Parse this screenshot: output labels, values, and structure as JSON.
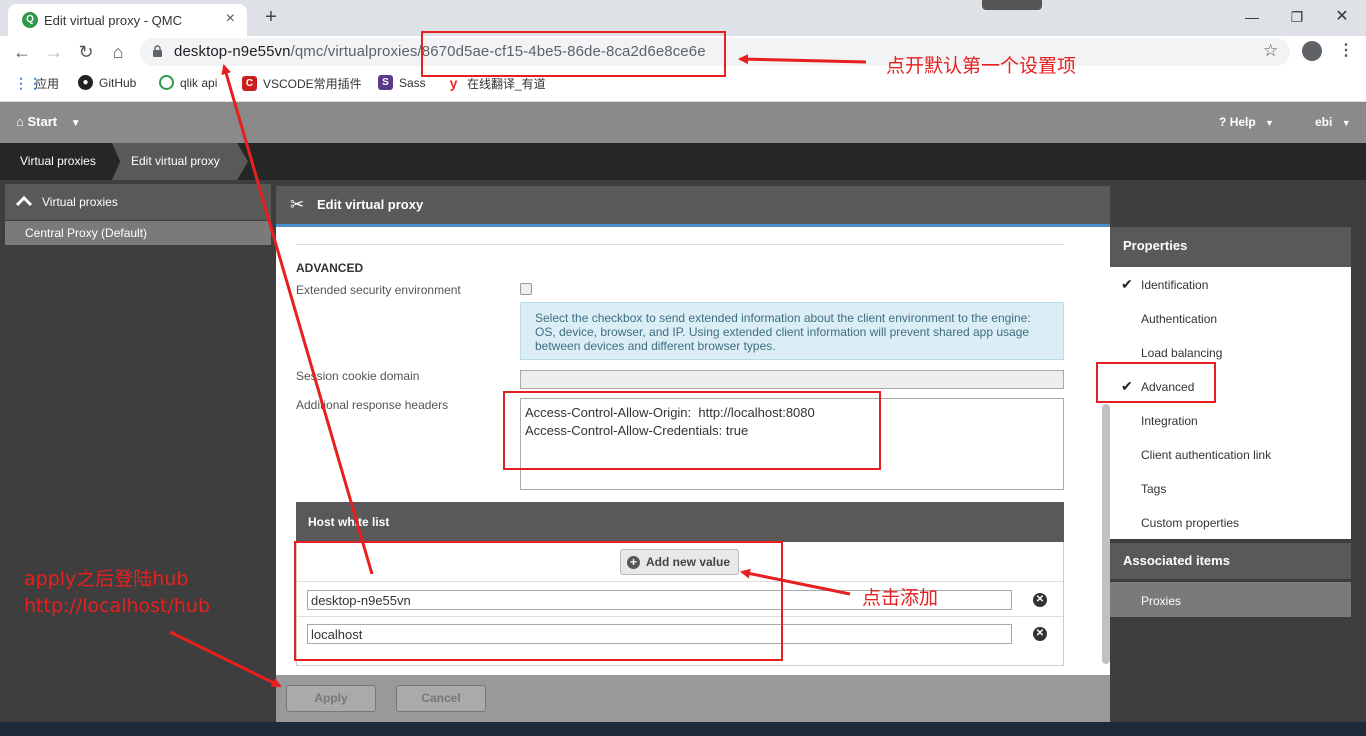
{
  "browser": {
    "tab_title": "Edit virtual proxy - QMC",
    "tab_favicon": "Q",
    "url_host": "desktop-n9e55vn",
    "url_path": "/qmc/virtualproxies/8670d5ae-cf15-4be5-86de-8ca2d6e8ce6e",
    "bookmarks": [
      {
        "label": "应用",
        "icon": "apps-grid-icon"
      },
      {
        "label": "GitHub",
        "icon": "github-icon"
      },
      {
        "label": "qlik api",
        "icon": "qlik-icon"
      },
      {
        "label": "VSCODE常用插件",
        "icon": "csdn-icon"
      },
      {
        "label": "Sass",
        "icon": "s-icon"
      },
      {
        "label": "在线翻译_有道",
        "icon": "youdao-icon"
      }
    ]
  },
  "qmc": {
    "start_label": "Start",
    "help_label": "Help",
    "user_label": "ebi",
    "breadcrumbs": [
      "Virtual proxies",
      "Edit virtual proxy"
    ],
    "left_panel": {
      "title": "Virtual proxies",
      "item": "Central Proxy (Default)"
    },
    "edit_title": "Edit virtual proxy",
    "advanced": {
      "section_title": "ADVANCED",
      "extended_security_label": "Extended security environment",
      "extended_security_checked": false,
      "info_text": "Select the checkbox to send extended information about the client environment to the engine: OS, device, browser, and IP. Using extended client information will prevent shared app usage between devices and different browser types.",
      "session_cookie_label": "Session cookie domain",
      "session_cookie_value": "",
      "response_headers_label": "Additional response headers",
      "response_headers_value": "Access-Control-Allow-Origin:  http://localhost:8080\nAccess-Control-Allow-Credentials: true"
    },
    "host_white_list": {
      "title": "Host white list",
      "add_label": "Add new value",
      "hosts": [
        "desktop-n9e55vn",
        "localhost"
      ]
    },
    "actions": {
      "apply": "Apply",
      "cancel": "Cancel"
    },
    "properties": {
      "title": "Properties",
      "items": [
        {
          "label": "Identification",
          "checked": true
        },
        {
          "label": "Authentication",
          "checked": false
        },
        {
          "label": "Load balancing",
          "checked": false
        },
        {
          "label": "Advanced",
          "checked": true
        },
        {
          "label": "Integration",
          "checked": false
        },
        {
          "label": "Client authentication link",
          "checked": false
        },
        {
          "label": "Tags",
          "checked": false
        },
        {
          "label": "Custom properties",
          "checked": false
        }
      ],
      "associated_title": "Associated items",
      "associated_item": "Proxies"
    }
  },
  "annotations": {
    "top": "点开默认第一个设置项",
    "add": "点击添加",
    "left_line1": "apply之后登陆hub",
    "left_line2": "http://localhost/hub"
  },
  "colors": {
    "annotation_red": "#e62020",
    "qmc_dark": "#3e3e3e",
    "qmc_header": "#595959",
    "accent_blue": "#4a8fc9"
  }
}
